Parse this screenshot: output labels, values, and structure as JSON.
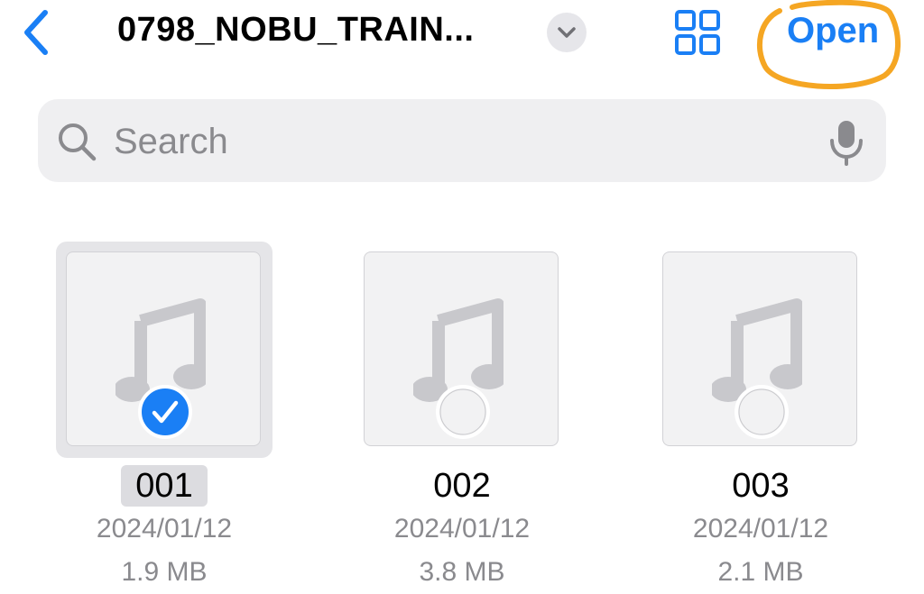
{
  "nav": {
    "title": "0798_NOBU_TRAIN...",
    "open_label": "Open"
  },
  "search": {
    "placeholder": "Search"
  },
  "files": [
    {
      "name": "001",
      "date": "2024/01/12",
      "size": "1.9 MB",
      "selected": true
    },
    {
      "name": "002",
      "date": "2024/01/12",
      "size": "3.8 MB",
      "selected": false
    },
    {
      "name": "003",
      "date": "2024/01/12",
      "size": "2.1 MB",
      "selected": false
    }
  ],
  "colors": {
    "accent": "#1a7ff5",
    "highlight_annotation": "#f5a623",
    "secondary_text": "#8a8a8e"
  },
  "icons": {
    "back": "chevron-left-icon",
    "title_menu": "chevron-down-icon",
    "view_toggle": "grid-icon",
    "search": "magnifier-icon",
    "mic": "microphone-icon",
    "file": "music-note-icon",
    "selected": "checkmark-circle-icon",
    "unselected": "empty-circle-icon"
  }
}
